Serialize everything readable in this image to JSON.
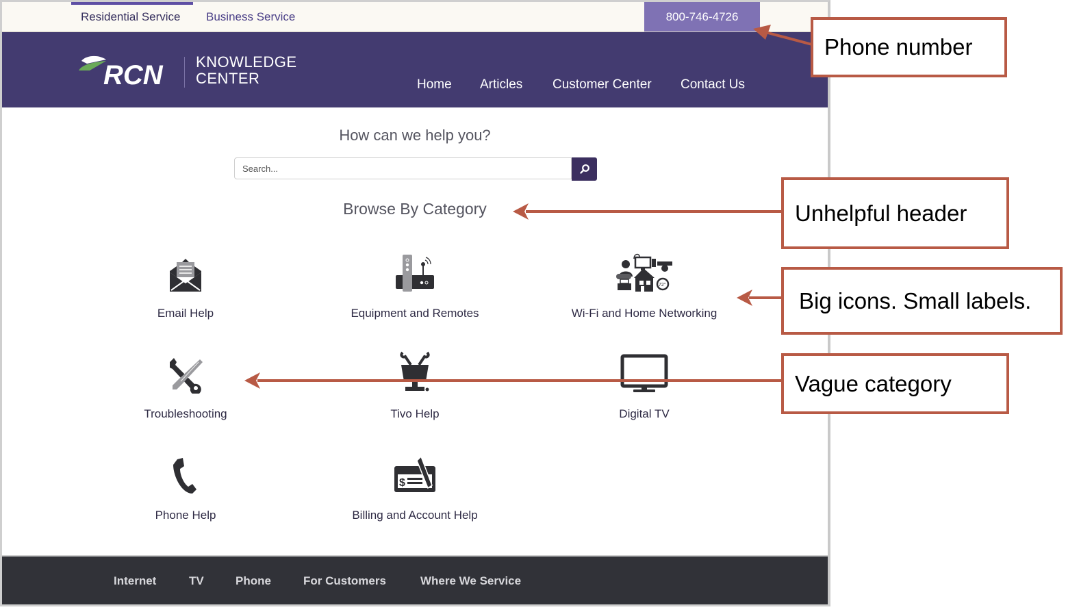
{
  "topbar": {
    "tabs": [
      {
        "label": "Residential Service",
        "active": true
      },
      {
        "label": "Business Service",
        "active": false
      }
    ],
    "phone": "800-746-4726"
  },
  "header": {
    "logo_text": "RCN",
    "subtitle_line1": "KNOWLEDGE",
    "subtitle_line2": "CENTER",
    "nav": [
      "Home",
      "Articles",
      "Customer Center",
      "Contact Us"
    ]
  },
  "main": {
    "question": "How can we help you?",
    "search": {
      "placeholder": "Search...",
      "value": "",
      "icon": "search-icon"
    },
    "browse_heading": "Browse By Category",
    "categories": [
      {
        "label": "Email Help",
        "icon": "envelope-icon"
      },
      {
        "label": "Equipment and Remotes",
        "icon": "router-icon"
      },
      {
        "label": "Wi-Fi and Home Networking",
        "icon": "home-network-icon"
      },
      {
        "label": "Troubleshooting",
        "icon": "tools-icon"
      },
      {
        "label": "Tivo Help",
        "icon": "tivo-icon"
      },
      {
        "label": "Digital TV",
        "icon": "monitor-icon"
      },
      {
        "label": "Phone Help",
        "icon": "phone-icon"
      },
      {
        "label": "Billing and Account Help",
        "icon": "check-pen-icon"
      }
    ]
  },
  "footer": {
    "nav": [
      "Internet",
      "TV",
      "Phone",
      "For Customers",
      "Where We Service"
    ]
  },
  "annotations": [
    {
      "text": "Phone number"
    },
    {
      "text": "Unhelpful header"
    },
    {
      "text": "Big icons. Small labels."
    },
    {
      "text": "Vague category"
    }
  ],
  "colors": {
    "brand_purple": "#433b70",
    "phone_bg": "#7f72b4",
    "footer_bg": "#313238",
    "annotation": "#b85a45",
    "logo_green": "#6aaa58"
  }
}
